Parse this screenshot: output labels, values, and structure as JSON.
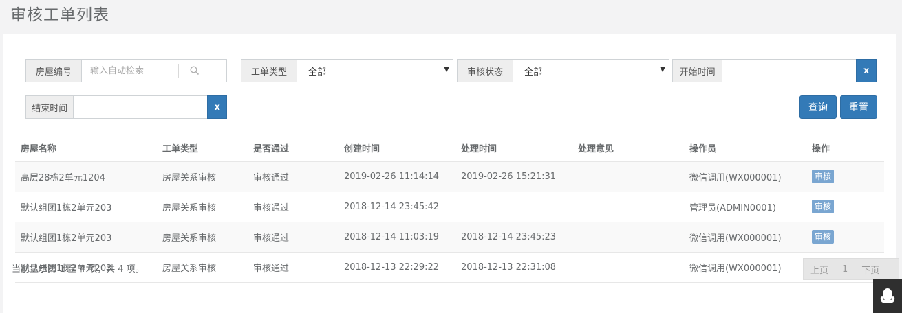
{
  "page": {
    "title": "审核工单列表"
  },
  "filters": {
    "house_no": {
      "label": "房屋编号",
      "placeholder": "输入自动检索",
      "value": ""
    },
    "order_type": {
      "label": "工单类型",
      "selected": "全部"
    },
    "audit_status": {
      "label": "审核状态",
      "selected": "全部"
    },
    "start_time": {
      "label": "开始时间",
      "value": "",
      "clear": "x"
    },
    "end_time": {
      "label": "结束时间",
      "value": "",
      "clear": "x"
    },
    "query_label": "查询",
    "reset_label": "重置"
  },
  "table": {
    "columns": [
      "房屋名称",
      "工单类型",
      "是否通过",
      "创建时间",
      "处理时间",
      "处理意见",
      "操作员",
      "操作"
    ],
    "rows": [
      {
        "house": "高层28栋2单元1204",
        "type": "房屋关系审核",
        "passed": "审核通过",
        "created": "2019-02-26 11:14:14",
        "processed": "2019-02-26 15:21:31",
        "opinion": "",
        "operator": "微信调用(WX000001)",
        "action": "审核"
      },
      {
        "house": "默认组团1栋2单元203",
        "type": "房屋关系审核",
        "passed": "审核通过",
        "created": "2018-12-14 23:45:42",
        "processed": "",
        "opinion": "",
        "operator": "管理员(ADMIN0001)",
        "action": "审核"
      },
      {
        "house": "默认组团1栋2单元203",
        "type": "房屋关系审核",
        "passed": "审核通过",
        "created": "2018-12-14 11:03:19",
        "processed": "2018-12-14 23:45:23",
        "opinion": "",
        "operator": "微信调用(WX000001)",
        "action": "审核"
      },
      {
        "house": "默认组团1栋2单元203",
        "type": "房屋关系审核",
        "passed": "审核通过",
        "created": "2018-12-13 22:29:22",
        "processed": "2018-12-13 22:31:08",
        "opinion": "",
        "operator": "微信调用(WX000001)",
        "action": "审核"
      }
    ]
  },
  "footer": {
    "info": "当前显示第 1 至 4 项，共 4 项。",
    "pager": {
      "prev": "上页",
      "page": "1",
      "next": "下页"
    }
  },
  "icons": {
    "search": "search-icon",
    "select_caret": "caret-down-icon",
    "chat": "qq-penguin-icon"
  },
  "colors": {
    "primary": "#337ab7",
    "audit_button": "#7aa6d1"
  }
}
